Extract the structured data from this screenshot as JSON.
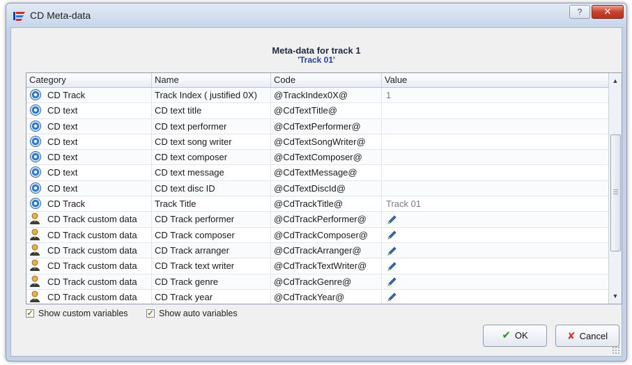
{
  "window": {
    "title": "CD Meta-data",
    "help_label": "?",
    "close_label": "✕"
  },
  "header": {
    "title": "Meta-data for track 1",
    "subtitle": "'Track 01'"
  },
  "table": {
    "columns": [
      "Category",
      "Name",
      "Code",
      "Value"
    ],
    "rows": [
      {
        "icon": "cd-disc-icon",
        "category": "CD Track",
        "name": "Track Index ( justified 0X)",
        "code": "@TrackIndex0X@",
        "value": "1",
        "editable": false
      },
      {
        "icon": "cd-disc-icon",
        "category": "CD text",
        "name": "CD text title",
        "code": "@CdTextTitle@",
        "value": "",
        "editable": false
      },
      {
        "icon": "cd-disc-icon",
        "category": "CD text",
        "name": "CD text performer",
        "code": "@CdTextPerformer@",
        "value": "",
        "editable": false
      },
      {
        "icon": "cd-disc-icon",
        "category": "CD text",
        "name": "CD text song writer",
        "code": "@CdTextSongWriter@",
        "value": "",
        "editable": false
      },
      {
        "icon": "cd-disc-icon",
        "category": "CD text",
        "name": "CD text composer",
        "code": "@CdTextComposer@",
        "value": "",
        "editable": false
      },
      {
        "icon": "cd-disc-icon",
        "category": "CD text",
        "name": "CD text message",
        "code": "@CdTextMessage@",
        "value": "",
        "editable": false
      },
      {
        "icon": "cd-disc-icon",
        "category": "CD text",
        "name": "CD text disc ID",
        "code": "@CdTextDiscId@",
        "value": "",
        "editable": false
      },
      {
        "icon": "cd-disc-icon",
        "category": "CD Track",
        "name": "Track Title",
        "code": "@CdTrackTitle@",
        "value": "Track 01",
        "editable": false
      },
      {
        "icon": "user-icon",
        "category": "CD Track custom data",
        "name": "CD Track performer",
        "code": "@CdTrackPerformer@",
        "value": "",
        "editable": true
      },
      {
        "icon": "user-icon",
        "category": "CD Track custom data",
        "name": "CD Track composer",
        "code": "@CdTrackComposer@",
        "value": "",
        "editable": true
      },
      {
        "icon": "user-icon",
        "category": "CD Track custom data",
        "name": "CD Track arranger",
        "code": "@CdTrackArranger@",
        "value": "",
        "editable": true
      },
      {
        "icon": "user-icon",
        "category": "CD Track custom data",
        "name": "CD Track text writer",
        "code": "@CdTrackTextWriter@",
        "value": "",
        "editable": true
      },
      {
        "icon": "user-icon",
        "category": "CD Track custom data",
        "name": "CD Track genre",
        "code": "@CdTrackGenre@",
        "value": "",
        "editable": true
      },
      {
        "icon": "user-icon",
        "category": "CD Track custom data",
        "name": "CD Track year",
        "code": "@CdTrackYear@",
        "value": "",
        "editable": true
      }
    ]
  },
  "options": {
    "show_custom_variables": {
      "label": "Show custom variables",
      "checked": true
    },
    "show_auto_variables": {
      "label": "Show auto variables",
      "checked": true
    }
  },
  "buttons": {
    "ok": "OK",
    "cancel": "Cancel"
  },
  "colors": {
    "accent": "#2a3f9a",
    "ok_check": "#2a8f28",
    "cancel_x": "#d23b2a"
  }
}
